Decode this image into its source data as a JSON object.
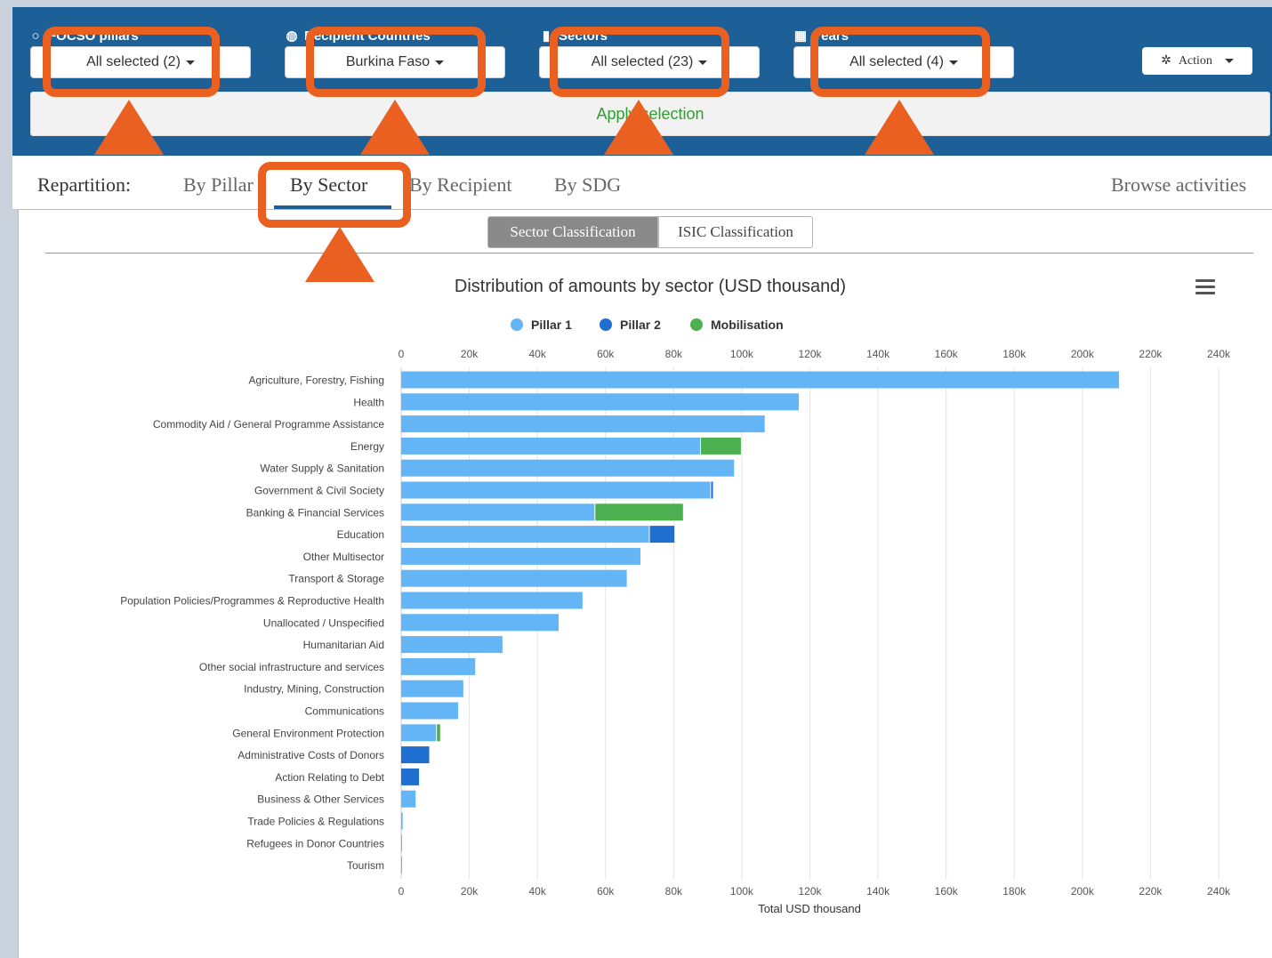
{
  "filters": {
    "pillars": {
      "label": "FOCSO pillars",
      "value": "All selected (2)"
    },
    "countries": {
      "label": "Recipient Countries",
      "value": "Burkina Faso"
    },
    "sectors": {
      "label": "Sectors",
      "value": "All selected (23)"
    },
    "years": {
      "label": "Years",
      "value": "All selected (4)"
    }
  },
  "action_label": "Action",
  "apply_label": "Apply selection",
  "tabs": {
    "label": "Repartition:",
    "items": [
      "By Pillar",
      "By Sector",
      "By Recipient",
      "By SDG"
    ],
    "active": "By Sector",
    "browse": "Browse activities"
  },
  "classification": {
    "sector": "Sector Classification",
    "isic": "ISIC Classification"
  },
  "colors": {
    "pillar1": "#64b5f6",
    "pillar2": "#1e6fd0",
    "mobilisation": "#4caf50",
    "highlight": "#ea6020",
    "header": "#1d5f97"
  },
  "chart_data": {
    "type": "bar",
    "orientation": "horizontal",
    "stacked": true,
    "title": "Distribution of amounts by sector (USD thousand)",
    "xlabel": "Total USD thousand",
    "xlim": [
      0,
      240000
    ],
    "ticks": [
      "0",
      "20k",
      "40k",
      "60k",
      "80k",
      "100k",
      "120k",
      "140k",
      "160k",
      "180k",
      "200k",
      "220k",
      "240k"
    ],
    "legend_position": "top",
    "categories": [
      "Agriculture, Forestry, Fishing",
      "Health",
      "Commodity Aid / General Programme Assistance",
      "Energy",
      "Water Supply & Sanitation",
      "Government & Civil Society",
      "Banking & Financial Services",
      "Education",
      "Other Multisector",
      "Transport & Storage",
      "Population Policies/Programmes & Reproductive Health",
      "Unallocated / Unspecified",
      "Humanitarian Aid",
      "Other social infrastructure and services",
      "Industry, Mining, Construction",
      "Communications",
      "General Environment Protection",
      "Administrative Costs of Donors",
      "Action Relating to Debt",
      "Business & Other Services",
      "Trade Policies & Regulations",
      "Refugees in Donor Countries",
      "Tourism"
    ],
    "series": [
      {
        "name": "Pillar 1",
        "color": "#64b5f6",
        "values": [
          211000,
          117000,
          107000,
          88000,
          98000,
          91000,
          57000,
          73000,
          70500,
          66500,
          53500,
          46500,
          30000,
          22000,
          18500,
          17000,
          10500,
          0,
          0,
          4500,
          700,
          400,
          100
        ]
      },
      {
        "name": "Pillar 2",
        "color": "#1e6fd0",
        "values": [
          0,
          0,
          0,
          0,
          0,
          800,
          0,
          7500,
          0,
          0,
          0,
          0,
          0,
          0,
          0,
          0,
          0,
          8500,
          5500,
          0,
          0,
          0,
          0
        ]
      },
      {
        "name": "Mobilisation",
        "color": "#4caf50",
        "values": [
          0,
          0,
          0,
          12000,
          0,
          0,
          26000,
          0,
          0,
          0,
          0,
          0,
          0,
          0,
          0,
          0,
          1200,
          0,
          0,
          0,
          0,
          0,
          0
        ]
      }
    ]
  }
}
